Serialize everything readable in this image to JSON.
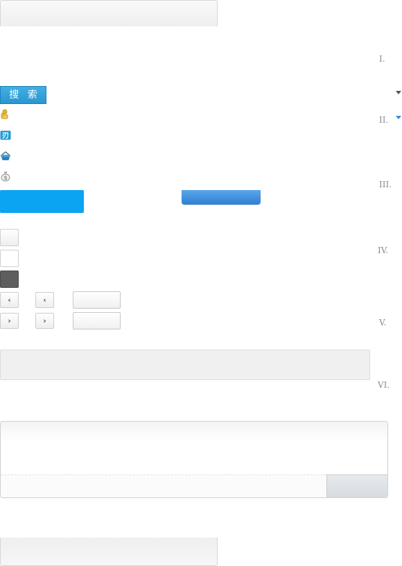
{
  "search": {
    "label": "搜 索"
  },
  "icons": [
    "coin-hand-icon",
    "coupon-icon",
    "basket-icon",
    "money-bag-icon"
  ],
  "steps": [
    "I.",
    "II.",
    "III.",
    "IV.",
    "V.",
    "VI."
  ],
  "pager": {
    "prev_symbol": "‹",
    "next_symbol": "›"
  },
  "colors": {
    "search_button": "#2a9fd6",
    "primary_button": "#0aa4f2",
    "gradient_button": "#3b8ad9",
    "caret_dark": "#555555",
    "caret_blue": "#3b8ad9"
  }
}
